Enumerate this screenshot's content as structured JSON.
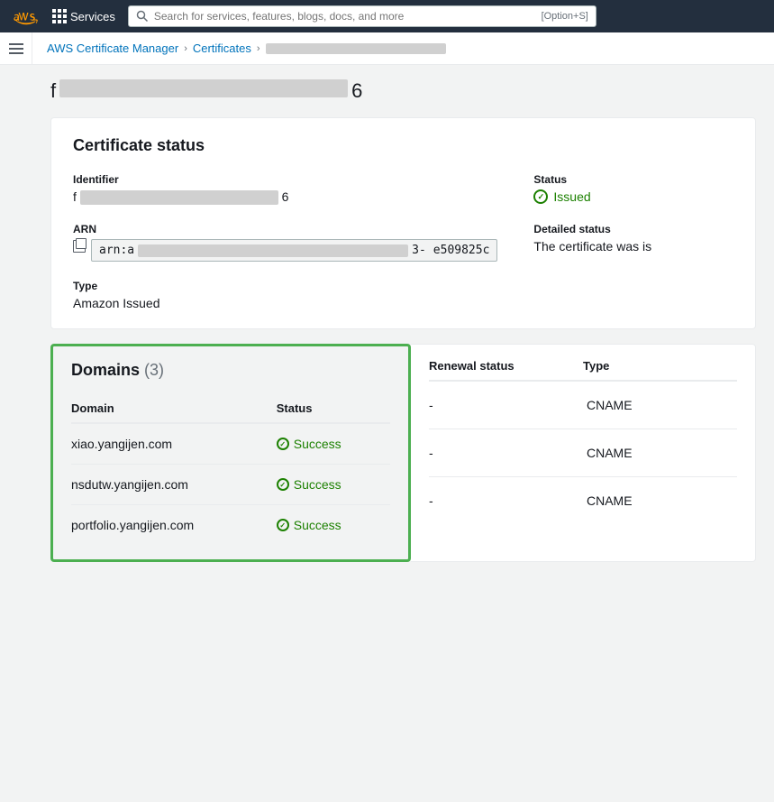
{
  "topnav": {
    "services_label": "Services",
    "search_placeholder": "Search for services, features, blogs, docs, and more",
    "search_shortcut": "[Option+S]"
  },
  "breadcrumb": {
    "root": "AWS Certificate Manager",
    "level2": "Certificates",
    "current_redacted": true
  },
  "page": {
    "title_prefix": "f",
    "title_suffix": "6"
  },
  "certificate_status": {
    "section_title": "Certificate status",
    "identifier_label": "Identifier",
    "identifier_prefix": "f",
    "identifier_suffix": "6",
    "status_label": "Status",
    "status_value": "Issued",
    "arn_label": "ARN",
    "arn_prefix": "arn:a",
    "arn_suffix": "3-",
    "arn_suffix2": "e509825c",
    "detailed_status_label": "Detailed status",
    "detailed_status_value": "The certificate was is",
    "type_label": "Type",
    "type_value": "Amazon Issued"
  },
  "domains": {
    "section_title": "Domains",
    "count": 3,
    "count_display": "(3)",
    "col_domain": "Domain",
    "col_status": "Status",
    "col_renewal": "Renewal status",
    "col_type": "Type",
    "rows": [
      {
        "domain": "xiao.yangijen.com",
        "status": "Success",
        "renewal": "-",
        "type": "CNAME"
      },
      {
        "domain": "nsdutw.yangijen.com",
        "status": "Success",
        "renewal": "-",
        "type": "CNAME"
      },
      {
        "domain": "portfolio.yangijen.com",
        "status": "Success",
        "renewal": "-",
        "type": "CNAME"
      }
    ]
  }
}
